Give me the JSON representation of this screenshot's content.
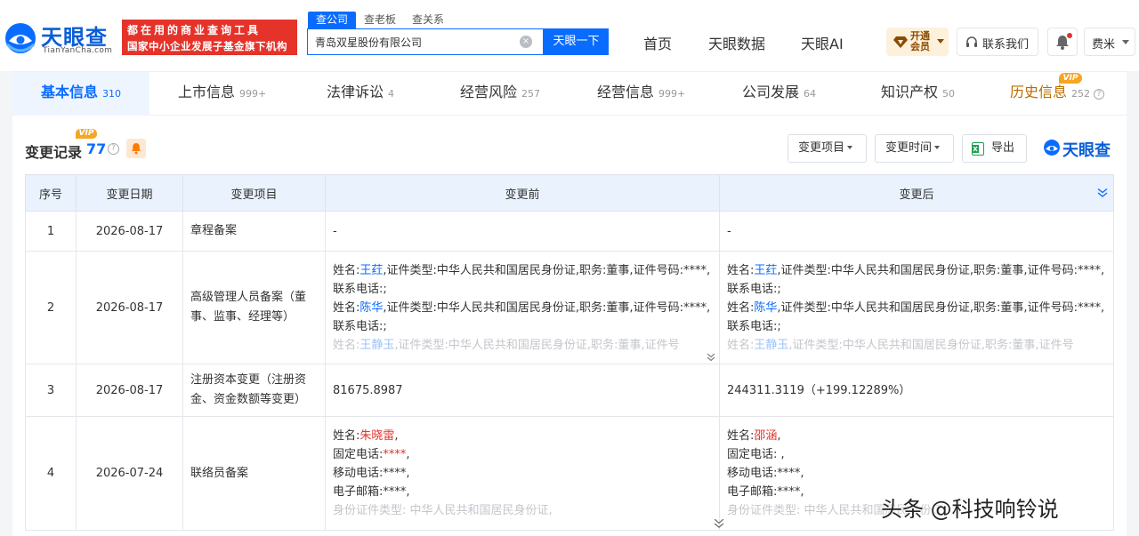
{
  "brand": {
    "name": "天眼查",
    "domain": "TianYanCha.com",
    "slogan_line1": "都在用的商业查询工具",
    "slogan_line2": "国家中小企业发展子基金旗下机构"
  },
  "search": {
    "tabs": [
      "查公司",
      "查老板",
      "查关系"
    ],
    "value": "青岛双星股份有限公司",
    "clear_icon": "×",
    "button": "天眼一下"
  },
  "nav": {
    "home": "首页",
    "data": "天眼数据",
    "ai": "天眼AI",
    "open_vip": "开通会员",
    "contact": "联系我们",
    "user": "费米"
  },
  "colors": {
    "brand_blue": "#0a6cff",
    "accent_red": "#e5332a",
    "vip_gold": "#f5a623"
  },
  "category_tabs": [
    {
      "label": "基本信息",
      "count": "310"
    },
    {
      "label": "上市信息",
      "count": "999+"
    },
    {
      "label": "法律诉讼",
      "count": "4"
    },
    {
      "label": "经营风险",
      "count": "257"
    },
    {
      "label": "经营信息",
      "count": "999+"
    },
    {
      "label": "公司发展",
      "count": "64"
    },
    {
      "label": "知识产权",
      "count": "50"
    },
    {
      "label": "历史信息",
      "count": "252"
    }
  ],
  "vip_badge": "VIP",
  "help_glyph": "?",
  "section": {
    "title": "变更记录",
    "count": "77",
    "filter_item": "变更项目",
    "filter_time": "变更时间",
    "export": "导出",
    "watermark": "天眼查"
  },
  "table": {
    "headers": [
      "序号",
      "变更日期",
      "变更项目",
      "变更前",
      "变更后"
    ],
    "rows": [
      {
        "idx": "1",
        "date": "2026-08-17",
        "item": "章程备案",
        "before": "-",
        "after": "-"
      },
      {
        "idx": "2",
        "date": "2026-08-17",
        "item": "高级管理人员备案（董事、监事、经理等）",
        "b1_pre": "姓名:",
        "b1_name": "王荭",
        "b1_post": ",证件类型:中华人民共和国居民身份证,职务:董事,证件号码:****,联系电话:;",
        "b2_pre": "姓名:",
        "b2_name": "陈华",
        "b2_post": ",证件类型:中华人民共和国居民身份证,职务:董事,证件号码:****,联系电话:;",
        "b3_pre": "姓名:",
        "b3_name": "王静玉",
        "b3_post": ",证件类型:中华人民共和国居民身份证,职务:董事,证件号",
        "a1_pre": "姓名:",
        "a1_name": "王荭",
        "a1_post": ",证件类型:中华人民共和国居民身份证,职务:董事,证件号码:****,联系电话:;",
        "a2_pre": "姓名:",
        "a2_name": "陈华",
        "a2_post": ",证件类型:中华人民共和国居民身份证,职务:董事,证件号码:****,联系电话:;",
        "a3_pre": "姓名:",
        "a3_name": "王静玉",
        "a3_post": ",证件类型:中华人民共和国居民身份证,职务:董事,证件号"
      },
      {
        "idx": "3",
        "date": "2026-08-17",
        "item": "注册资本变更（注册资金、资金数额等变更）",
        "before": "81675.8987",
        "after": "244311.3119（+199.12289%）"
      },
      {
        "idx": "4",
        "date": "2026-07-24",
        "item": "联络员备案",
        "b_name_label": "姓名:",
        "b_name": "朱晓雷",
        "b_name_post": ",",
        "b_phone_label": "固定电话:",
        "b_phone": "****",
        "b_phone_post": ",",
        "b_mobile": "移动电话:****,",
        "b_email": "电子邮箱:****,",
        "b_id": "身份证件类型: 中华人民共和国居民身份证,",
        "a_name_label": "姓名:",
        "a_name": "邵涵",
        "a_name_post": ",",
        "a_phone": "固定电话:  ,",
        "a_mobile": "移动电话:****,",
        "a_email": "电子邮箱:****,",
        "a_id": "身份证件类型: 中华人民共和国居民身份证,"
      }
    ]
  },
  "watermark": "头条 @科技响铃说"
}
